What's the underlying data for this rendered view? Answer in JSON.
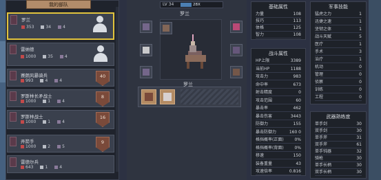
{
  "roster": {
    "title": "我的部队",
    "units": [
      {
        "name": "罗兰",
        "hp": "353",
        "troops": "34",
        "level": "4",
        "selected": true,
        "badge": ""
      },
      {
        "name": "雷纳德",
        "hp": "1000",
        "troops": "35",
        "level": "4",
        "selected": false,
        "badge": ""
      },
      {
        "name": "赛朗风暴骑兵",
        "hp": "993",
        "troops": "4",
        "level": "4",
        "selected": false,
        "badge": "40"
      },
      {
        "name": "罗斯林长矛战士",
        "hp": "1000",
        "troops": "1",
        "level": "4",
        "selected": false,
        "badge": "8"
      },
      {
        "name": "罗斯林战士",
        "hp": "1000",
        "troops": "1",
        "level": "4",
        "selected": false,
        "badge": "16"
      },
      {
        "name": "弄箭手",
        "hp": "1000",
        "troops": "2",
        "level": "5",
        "selected": false,
        "badge": "9"
      },
      {
        "name": "雷德尔兵",
        "hp": "643",
        "troops": "1",
        "level": "4",
        "selected": false,
        "badge": ""
      }
    ]
  },
  "hero": {
    "lv_label": "LV 34",
    "xp_text": "28X",
    "xp_fraction": 0.28,
    "name_top": "罗兰",
    "name_caption": "罗兰"
  },
  "base_attrs": {
    "title": "基础属性",
    "rows": [
      {
        "k": "力量",
        "v": "108"
      },
      {
        "k": "技巧",
        "v": "113"
      },
      {
        "k": "体格",
        "v": "125"
      },
      {
        "k": "智力",
        "v": "108"
      }
    ]
  },
  "combat_attrs": {
    "title": "战斗属性",
    "rows": [
      {
        "k": "HP上限",
        "v": "3389"
      },
      {
        "k": "当前HP",
        "v": "1188"
      },
      {
        "k": "攻击力",
        "v": "983"
      },
      {
        "k": "命中率",
        "v": "673"
      },
      {
        "k": "射击精度",
        "v": "0"
      },
      {
        "k": "攻击范围",
        "v": "60"
      },
      {
        "k": "暴击率",
        "v": "462"
      },
      {
        "k": "暴击伤害",
        "v": "3443"
      },
      {
        "k": "防御力",
        "v": "155"
      },
      {
        "k": "暴击防御力",
        "v": "160 0"
      },
      {
        "k": "格挡概率(正面)",
        "v": "0%"
      },
      {
        "k": "格挡概率(背面)",
        "v": "0%"
      },
      {
        "k": "移速",
        "v": "150"
      },
      {
        "k": "装备重量",
        "v": "43"
      },
      {
        "k": "攻速倍率",
        "v": "0.816"
      }
    ]
  },
  "military_skills": {
    "title": "军事技能",
    "rows": [
      {
        "k": "猛虎之力",
        "v": "1"
      },
      {
        "k": "迅捷之速",
        "v": "1"
      },
      {
        "k": "坚韧之体",
        "v": "1"
      },
      {
        "k": "战斗天赋",
        "v": "5"
      },
      {
        "k": "医疗",
        "v": "1"
      },
      {
        "k": "手术",
        "v": "3"
      },
      {
        "k": "治疗",
        "v": "1"
      },
      {
        "k": "机动",
        "v": "0"
      },
      {
        "k": "管理",
        "v": "0"
      },
      {
        "k": "侦察",
        "v": "0"
      },
      {
        "k": "训练",
        "v": "0"
      },
      {
        "k": "工程",
        "v": "0"
      }
    ]
  },
  "weapon_skills": {
    "title": "武器熟练度",
    "rows": [
      {
        "k": "单手剑",
        "v": "30"
      },
      {
        "k": "双手剑",
        "v": "30"
      },
      {
        "k": "单手斧",
        "v": "31"
      },
      {
        "k": "双手斧",
        "v": "61"
      },
      {
        "k": "单手钝器",
        "v": "32"
      },
      {
        "k": "骑枪",
        "v": "30"
      },
      {
        "k": "单手长柄",
        "v": "30"
      },
      {
        "k": "双手长柄",
        "v": "30"
      }
    ]
  },
  "colors": {
    "selected_border": "#e2c43c",
    "xp_bar": "#4c7fb2",
    "badge": "#7a4a3a"
  }
}
